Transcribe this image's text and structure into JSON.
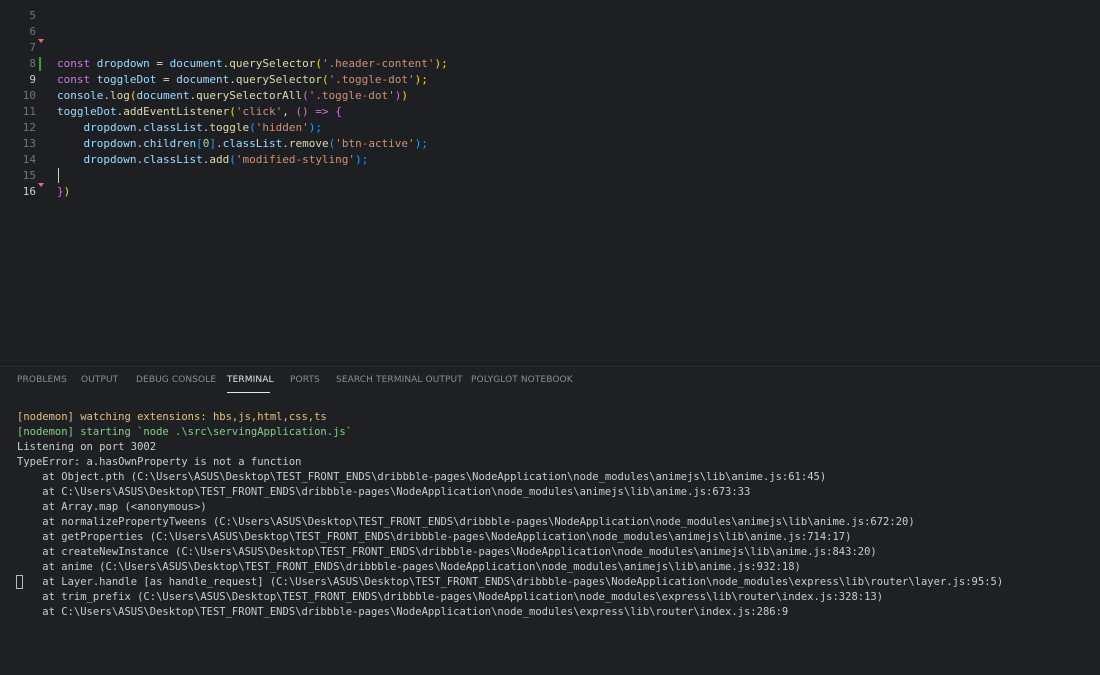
{
  "editor": {
    "top_partial_line_number": "5",
    "lines": [
      {
        "num": "6"
      },
      {
        "num": "7"
      },
      {
        "num": "8"
      },
      {
        "num": "9"
      },
      {
        "num": "10"
      },
      {
        "num": "11"
      },
      {
        "num": "12"
      },
      {
        "num": "13"
      },
      {
        "num": "14"
      },
      {
        "num": "15"
      },
      {
        "num": "16"
      }
    ],
    "tokens": {
      "l7": [
        "const",
        " ",
        "dropdown",
        " = ",
        "document",
        ".",
        "querySelector",
        "(",
        "'.header-content'",
        ");"
      ],
      "l8": [
        "const",
        " ",
        "toggleDot",
        " = ",
        "document",
        ".",
        "querySelector",
        "(",
        "'.toggle-dot'",
        ");"
      ],
      "l9": [
        "console",
        ".",
        "log",
        "(",
        "document",
        ".",
        "querySelectorAll",
        "(",
        "'.toggle-dot'",
        ")",
        ")"
      ],
      "l10": [
        "toggleDot",
        ".",
        "addEventListener",
        "(",
        "'click'",
        ", ",
        "()",
        " => ",
        "{"
      ],
      "l11": [
        "    ",
        "dropdown",
        ".",
        "classList",
        ".",
        "toggle",
        "(",
        "'hidden'",
        ");"
      ],
      "l12": [
        "    ",
        "dropdown",
        ".",
        "children",
        "[",
        "0",
        "]",
        ".",
        "classList",
        ".",
        "remove",
        "(",
        "'btn-active'",
        ");"
      ],
      "l13": [
        "    ",
        "dropdown",
        ".",
        "classList",
        ".",
        "add",
        "(",
        "'modified-styling'",
        ");"
      ],
      "l15": [
        "}",
        ")"
      ]
    }
  },
  "panel": {
    "tabs": [
      {
        "label": "PROBLEMS"
      },
      {
        "label": "OUTPUT"
      },
      {
        "label": "DEBUG CONSOLE"
      },
      {
        "label": "TERMINAL"
      },
      {
        "label": "PORTS"
      },
      {
        "label": "SEARCH TERMINAL OUTPUT"
      },
      {
        "label": "POLYGLOT NOTEBOOK"
      }
    ],
    "active_tab": "TERMINAL",
    "terminal_lines": [
      "[nodemon] watching extensions: hbs,js,html,css,ts",
      "[nodemon] starting `node .\\src\\servingApplication.js`",
      "Listening on port 3002",
      "TypeError: a.hasOwnProperty is not a function",
      "    at Object.pth (C:\\Users\\ASUS\\Desktop\\TEST_FRONT_ENDS\\dribbble-pages\\NodeApplication\\node_modules\\animejs\\lib\\anime.js:61:45)",
      "    at C:\\Users\\ASUS\\Desktop\\TEST_FRONT_ENDS\\dribbble-pages\\NodeApplication\\node_modules\\animejs\\lib\\anime.js:673:33",
      "    at Array.map (<anonymous>)",
      "    at normalizePropertyTweens (C:\\Users\\ASUS\\Desktop\\TEST_FRONT_ENDS\\dribbble-pages\\NodeApplication\\node_modules\\animejs\\lib\\anime.js:672:20)",
      "    at getProperties (C:\\Users\\ASUS\\Desktop\\TEST_FRONT_ENDS\\dribbble-pages\\NodeApplication\\node_modules\\animejs\\lib\\anime.js:714:17)",
      "    at createNewInstance (C:\\Users\\ASUS\\Desktop\\TEST_FRONT_ENDS\\dribbble-pages\\NodeApplication\\node_modules\\animejs\\lib\\anime.js:843:20)",
      "    at anime (C:\\Users\\ASUS\\Desktop\\TEST_FRONT_ENDS\\dribbble-pages\\NodeApplication\\node_modules\\animejs\\lib\\anime.js:932:18)",
      "    at Layer.handle [as handle_request] (C:\\Users\\ASUS\\Desktop\\TEST_FRONT_ENDS\\dribbble-pages\\NodeApplication\\node_modules\\express\\lib\\router\\layer.js:95:5)",
      "    at trim_prefix (C:\\Users\\ASUS\\Desktop\\TEST_FRONT_ENDS\\dribbble-pages\\NodeApplication\\node_modules\\express\\lib\\router\\index.js:328:13)",
      "    at C:\\Users\\ASUS\\Desktop\\TEST_FRONT_ENDS\\dribbble-pages\\NodeApplication\\node_modules\\express\\lib\\router\\index.js:286:9"
    ]
  },
  "colors": {
    "editor_bg": "#1e1f22",
    "keyword": "#c678dd",
    "string": "#ce9178",
    "nodemon": "#e5c07b",
    "git_modified": "#2ea043"
  }
}
